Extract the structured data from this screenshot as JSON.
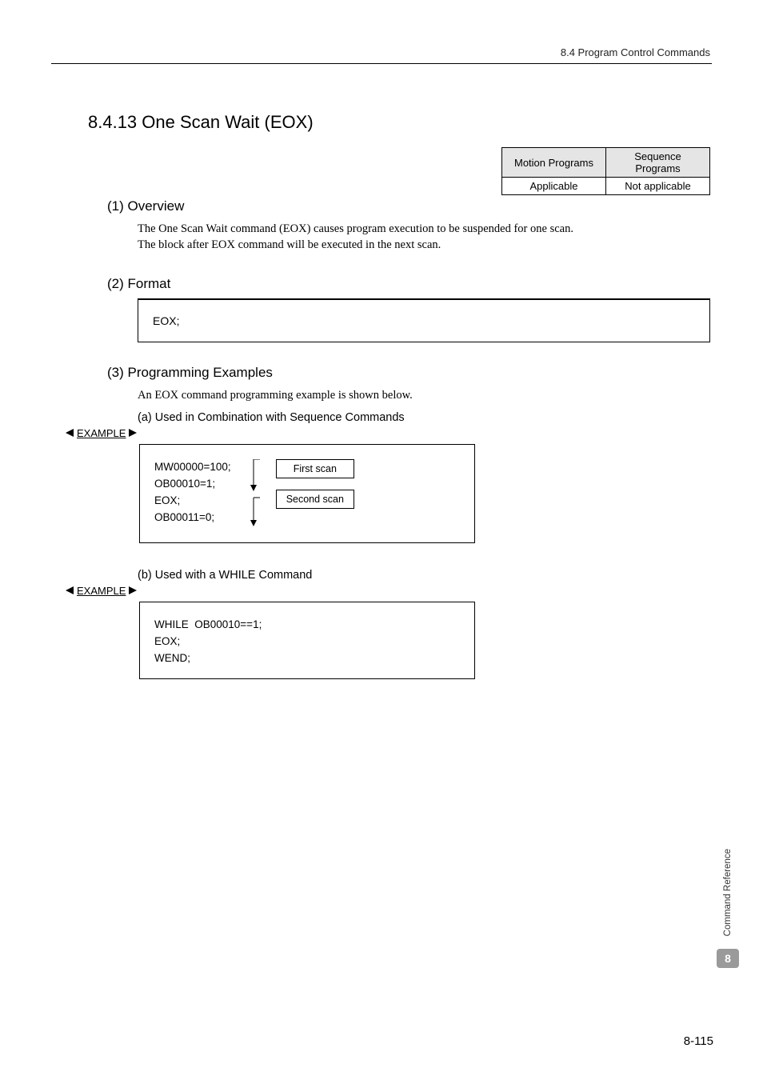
{
  "header": {
    "right": "8.4  Program Control Commands"
  },
  "section": {
    "title": "8.4.13  One Scan Wait (EOX)"
  },
  "table": {
    "h1": "Motion Programs",
    "h2": "Sequence Programs",
    "c1": "Applicable",
    "c2": "Not applicable"
  },
  "overview": {
    "head": "(1) Overview",
    "l1": "The One Scan Wait command (EOX) causes program execution to be suspended for one scan.",
    "l2": "The block after EOX command will be executed in the next scan."
  },
  "format": {
    "head": "(2) Format",
    "code": "EOX;"
  },
  "prog": {
    "head": "(3) Programming Examples",
    "intro": "An EOX command programming example is shown below.",
    "a_head": "(a) Used in Combination with Sequence Commands",
    "b_head": "(b) Used with a WHILE Command"
  },
  "example_label": "EXAMPLE",
  "exA": {
    "l1": "MW00000=100;",
    "l2": "OB00010=1;",
    "l3": "EOX;",
    "l4": "OB00011=0;",
    "scan1": "First scan",
    "scan2": "Second scan"
  },
  "exB": {
    "l1": "WHILE  OB00010==1;",
    "l2": "EOX;",
    "l3": "WEND;"
  },
  "side": {
    "text": "Command Reference",
    "badge": "8"
  },
  "footer": {
    "page": "8-115"
  }
}
